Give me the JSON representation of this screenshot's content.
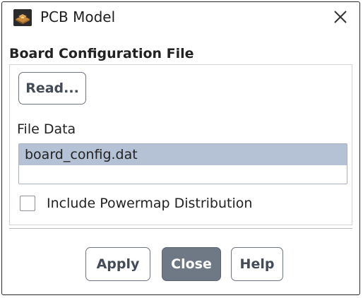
{
  "window": {
    "title": "PCB Model",
    "icon": "pcb-board-icon"
  },
  "board_config": {
    "section_title": "Board Configuration File",
    "read_button_label": "Read...",
    "file_data_label": "File Data",
    "file_list": [
      {
        "name": "board_config.dat",
        "selected": true
      },
      {
        "name": "",
        "selected": false
      }
    ],
    "include_powermap": {
      "label": "Include Powermap Distribution",
      "checked": false
    }
  },
  "actions": {
    "apply_label": "Apply",
    "close_label": "Close",
    "help_label": "Help"
  },
  "colors": {
    "selection": "#b5c2d5",
    "primary_button": "#6f7986",
    "button_text": "#434b57"
  }
}
